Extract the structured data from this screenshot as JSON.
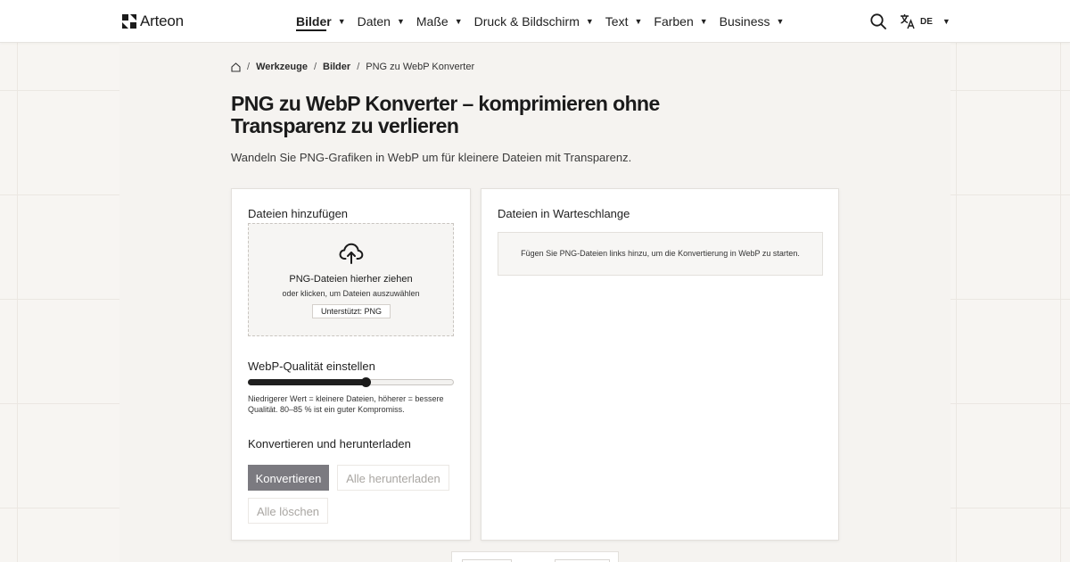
{
  "header": {
    "logo_text": "Arteon",
    "nav": [
      {
        "label": "Bilder",
        "active": true
      },
      {
        "label": "Daten"
      },
      {
        "label": "Maße"
      },
      {
        "label": "Druck & Bildschirm"
      },
      {
        "label": "Text"
      },
      {
        "label": "Farben"
      },
      {
        "label": "Business"
      }
    ],
    "caret": "▼",
    "language": "DE"
  },
  "breadcrumb": {
    "items": [
      "Werkzeuge",
      "Bilder",
      "PNG zu WebP Konverter"
    ],
    "separator": "/"
  },
  "page": {
    "title": "PNG zu WebP Konverter – komprimieren ohne Transparenz zu verlieren",
    "subtitle": "Wandeln Sie PNG-Grafiken in WebP um für kleinere Dateien mit Transparenz."
  },
  "upload": {
    "title": "Dateien hinzufügen",
    "drop_main": "PNG-Dateien hierher ziehen",
    "drop_sub": "oder klicken, um Dateien auszuwählen",
    "supported": "Unterstützt: PNG"
  },
  "quality": {
    "title": "WebP-Qualität einstellen",
    "value_fraction": 0.57,
    "hint": "Niedrigerer Wert = kleinere Dateien, höherer = bessere Qualität. 80–85 % ist ein guter Kompromiss."
  },
  "convert": {
    "title": "Konvertieren und herunterladen",
    "convert_label": "Konvertieren",
    "download_all_label": "Alle herunterladen",
    "clear_all_label": "Alle löschen"
  },
  "queue": {
    "title": "Dateien in Warteschlange",
    "empty_text": "Fügen Sie PNG-Dateien links hinzu, um die Konvertierung in WebP zu starten."
  },
  "colors": {
    "accent": "#1b1b1b",
    "primary_button": "#7b7a80",
    "background": "#f7f5f2"
  },
  "icons": [
    "logo-icon",
    "search-icon",
    "translate-icon",
    "home-icon",
    "cloud-upload-icon"
  ]
}
